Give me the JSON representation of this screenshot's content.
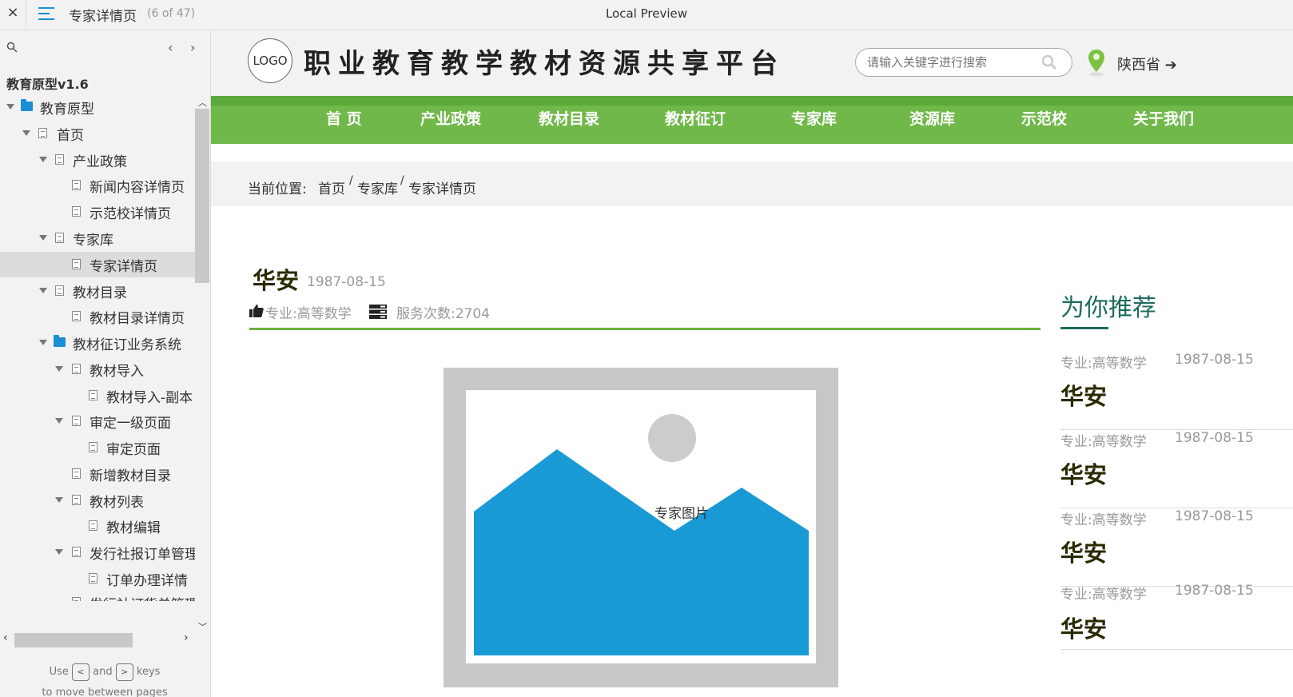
{
  "toolbar": {
    "close_label": "×",
    "page_title": "专家详情页",
    "page_count": "(6 of 47)",
    "preview_label": "Local Preview"
  },
  "sidebar": {
    "project_name": "教育原型v1.6",
    "prev_label": "‹",
    "next_label": "›",
    "tree": [
      {
        "label": "教育原型",
        "type": "folder",
        "expanded": true,
        "selected": false
      },
      {
        "label": "首页",
        "type": "page",
        "expanded": true,
        "selected": false
      },
      {
        "label": "产业政策",
        "type": "page",
        "expanded": true,
        "selected": false
      },
      {
        "label": "新闻内容详情页",
        "type": "page",
        "expanded": false,
        "selected": false
      },
      {
        "label": "示范校详情页",
        "type": "page",
        "expanded": false,
        "selected": false
      },
      {
        "label": "专家库",
        "type": "page",
        "expanded": true,
        "selected": false
      },
      {
        "label": "专家详情页",
        "type": "page",
        "expanded": false,
        "selected": true
      },
      {
        "label": "教材目录",
        "type": "page",
        "expanded": true,
        "selected": false
      },
      {
        "label": "教材目录详情页",
        "type": "page",
        "expanded": false,
        "selected": false
      },
      {
        "label": "教材征订业务系统",
        "type": "folder",
        "expanded": true,
        "selected": false
      },
      {
        "label": "教材导入",
        "type": "page",
        "expanded": true,
        "selected": false
      },
      {
        "label": "教材导入-副本",
        "type": "page",
        "expanded": false,
        "selected": false
      },
      {
        "label": "审定一级页面",
        "type": "page",
        "expanded": true,
        "selected": false
      },
      {
        "label": "审定页面",
        "type": "page",
        "expanded": false,
        "selected": false
      },
      {
        "label": "新增教材目录",
        "type": "page",
        "expanded": false,
        "selected": false
      },
      {
        "label": "教材列表",
        "type": "page",
        "expanded": true,
        "selected": false
      },
      {
        "label": "教材编辑",
        "type": "page",
        "expanded": false,
        "selected": false
      },
      {
        "label": "发行社报订单管理",
        "type": "page",
        "expanded": true,
        "selected": false
      },
      {
        "label": "订单办理详情",
        "type": "page",
        "expanded": false,
        "selected": false
      },
      {
        "label": "发行社订货单管理",
        "type": "page",
        "expanded": true,
        "selected": false
      }
    ],
    "hint_use": "Use",
    "hint_and": "and",
    "hint_keys": "keys",
    "hint_line2": "to move between pages"
  },
  "site": {
    "logo_text": "LOGO",
    "title": "职业教育教学教材资源共享平台",
    "search_placeholder": "请输入关键字进行搜索",
    "location": "陕西省",
    "nav": [
      "首 页",
      "产业政策",
      "教材目录",
      "教材征订",
      "专家库",
      "资源库",
      "示范校",
      "关于我们"
    ],
    "breadcrumb": {
      "prefix": "当前位置:",
      "items": [
        "首页",
        "专家库",
        "专家详情页"
      ],
      "separator": "/"
    },
    "expert": {
      "name": "华安",
      "birth_date": "1987-08-15",
      "major": "专业:高等数学",
      "service_count": "服务次数:2704",
      "photo_label": "专家图片"
    },
    "recommend": {
      "title": "为你推荐",
      "items": [
        {
          "major": "专业:高等数学",
          "date": "1987-08-15",
          "name": "华安"
        },
        {
          "major": "专业:高等数学",
          "date": "1987-08-15",
          "name": "华安"
        },
        {
          "major": "专业:高等数学",
          "date": "1987-08-15",
          "name": "华安"
        },
        {
          "major": "专业:高等数学",
          "date": "1987-08-15",
          "name": "华安"
        }
      ]
    }
  },
  "colors": {
    "nav_green": "#70b84a",
    "accent_blue": "#1a8fd6",
    "photo_blue": "#1a9ad4",
    "recommend_teal": "#1e6b5e"
  }
}
